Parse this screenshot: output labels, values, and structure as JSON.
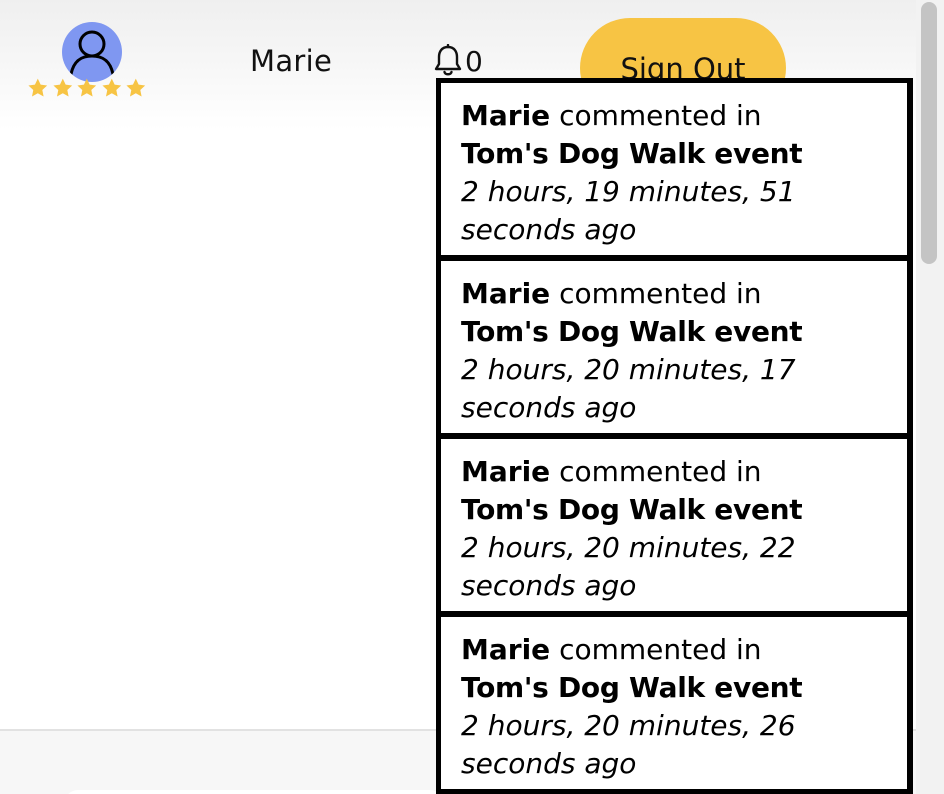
{
  "header": {
    "user_name": "Marie",
    "rating_stars": 5,
    "star_color": "#f7c444",
    "notification_count": "0",
    "sign_out_label": "Sign Out",
    "sign_out_color": "#f7c444",
    "avatar_color": "#7f97f1"
  },
  "notifications": [
    {
      "user": "Marie",
      "action": "commented in",
      "event": "Tom's Dog Walk event",
      "time": "2 hours, 19 minutes, 51 seconds ago"
    },
    {
      "user": "Marie",
      "action": "commented in",
      "event": "Tom's Dog Walk event",
      "time": "2 hours, 20 minutes, 17 seconds ago"
    },
    {
      "user": "Marie",
      "action": "commented in",
      "event": "Tom's Dog Walk event",
      "time": "2 hours, 20 minutes, 22 seconds ago"
    },
    {
      "user": "Marie",
      "action": "commented in",
      "event": "Tom's Dog Walk event",
      "time": "2 hours, 20 minutes, 26 seconds ago"
    }
  ],
  "icons": {
    "avatar": "user-avatar-icon",
    "rating": "star-icon",
    "notifications": "bell-icon"
  }
}
